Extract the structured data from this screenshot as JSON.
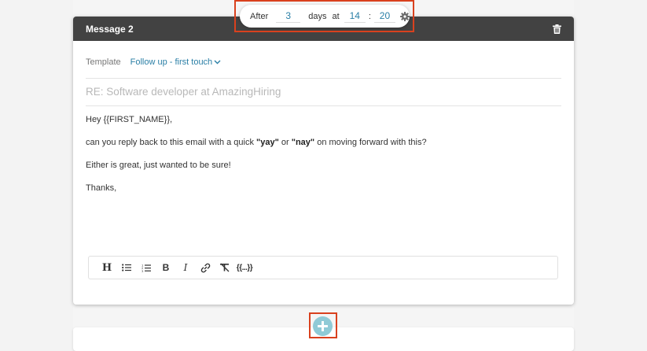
{
  "message": {
    "title": "Message 2",
    "template_label": "Template",
    "template_value": "Follow up - first touch",
    "subject_placeholder": "RE: Software developer at AmazingHiring",
    "body": {
      "greeting": "Hey {{FIRST_NAME}},",
      "line2_pre": "can you reply back to this email with a quick ",
      "line2_yay": "\"yay\"",
      "line2_or": " or ",
      "line2_nay": "\"nay\"",
      "line2_post": " on moving forward with this?",
      "line3": "Either is great, just wanted to be sure!",
      "signoff": "Thanks,"
    }
  },
  "schedule": {
    "after_label": "After",
    "days_value": "3",
    "days_label": "days",
    "at_label": "at",
    "hour_value": "14",
    "colon": ":",
    "minute_value": "20"
  },
  "toolbar": {
    "heading": "H",
    "bold": "B",
    "italic": "I",
    "variable": "{{...}}"
  },
  "icons": {
    "delete": "trash-icon",
    "settings": "gear-icon",
    "add": "plus-circle-icon",
    "dropdown": "chevron-down-icon"
  },
  "colors": {
    "header_bg": "#424242",
    "link_accent": "#2a7fa6",
    "highlight_border": "#d9411e",
    "add_button": "#8fcad6"
  }
}
